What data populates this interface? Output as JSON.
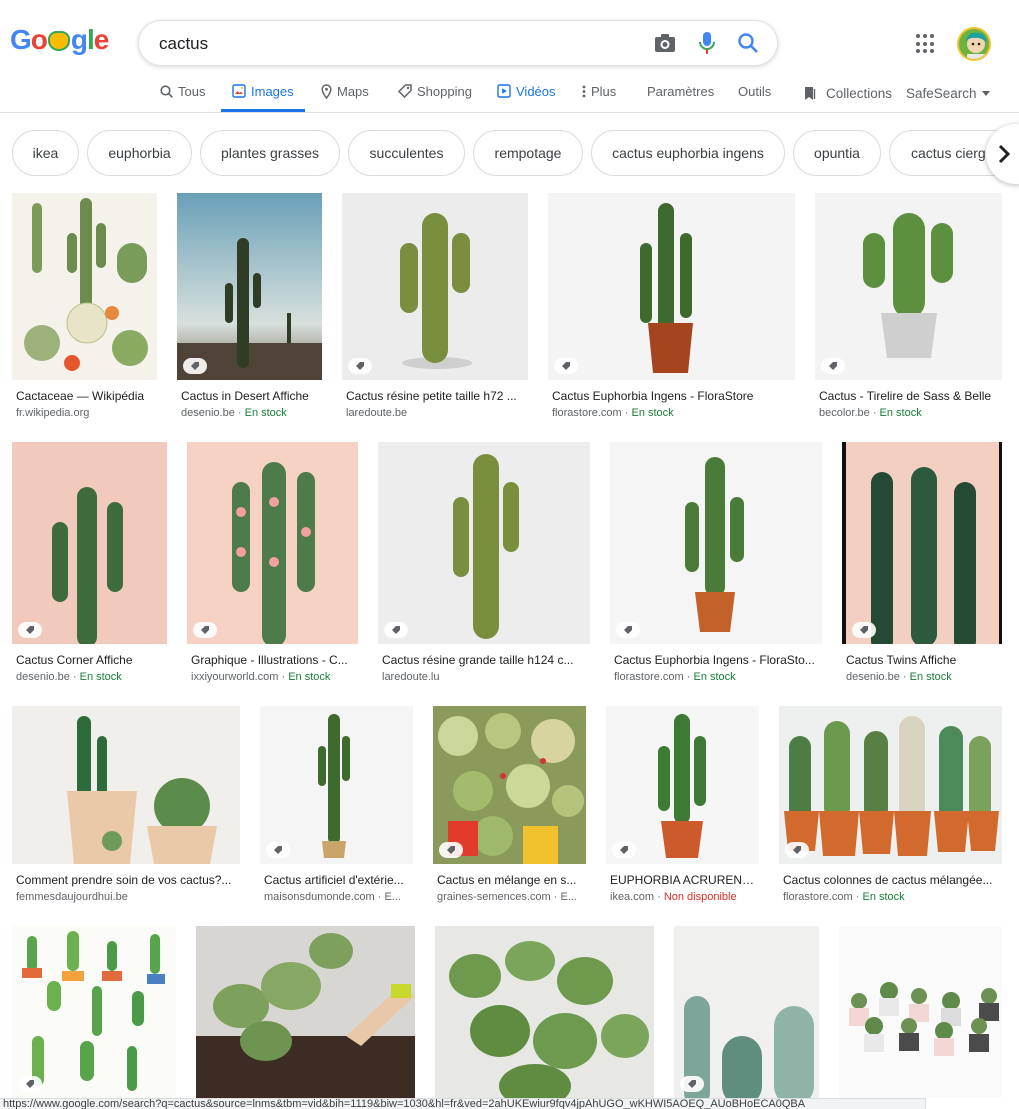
{
  "logo": {
    "text": "Google"
  },
  "search": {
    "query": "cactus",
    "icons": [
      "camera-icon",
      "microphone-icon",
      "search-icon"
    ]
  },
  "tabs": [
    {
      "label": "Tous",
      "icon": "search-icon"
    },
    {
      "label": "Images",
      "icon": "image-icon",
      "active": true
    },
    {
      "label": "Maps",
      "icon": "map-pin-icon"
    },
    {
      "label": "Shopping",
      "icon": "tag-icon"
    },
    {
      "label": "Vidéos",
      "icon": "play-icon"
    },
    {
      "label": "Plus",
      "icon": "more-vert-icon"
    },
    {
      "label": "Paramètres"
    },
    {
      "label": "Outils"
    }
  ],
  "right_tools": {
    "collections": "Collections",
    "safesearch": "SafeSearch"
  },
  "chips": [
    "ikea",
    "euphorbia",
    "plantes grasses",
    "succulentes",
    "rempotage",
    "cactus euphorbia ingens",
    "opuntia",
    "cactus cierge"
  ],
  "results": [
    {
      "title": "Cactaceae — Wikipédia",
      "source": "fr.wikipedia.org",
      "stock": ""
    },
    {
      "title": "Cactus in Desert Affiche",
      "source": "desenio.be",
      "stock": "En stock"
    },
    {
      "title": "Cactus résine petite taille h72 ...",
      "source": "laredoute.be",
      "stock": ""
    },
    {
      "title": "Cactus Euphorbia Ingens - FloraStore",
      "source": "florastore.com",
      "stock": "En stock"
    },
    {
      "title": "Cactus - Tirelire de Sass & Belle",
      "source": "becolor.be",
      "stock": "En stock"
    },
    {
      "title": "Cactus Corner Affiche",
      "source": "desenio.be",
      "stock": "En stock"
    },
    {
      "title": "Graphique - Illustrations - C...",
      "source": "ixxiyourworld.com",
      "stock": "En stock"
    },
    {
      "title": "Cactus résine grande taille h124 c...",
      "source": "laredoute.lu",
      "stock": ""
    },
    {
      "title": "Cactus Euphorbia Ingens - FloraSto...",
      "source": "florastore.com",
      "stock": "En stock"
    },
    {
      "title": "Cactus Twins Affiche",
      "source": "desenio.be",
      "stock": "En stock"
    },
    {
      "title": "Comment prendre soin de vos cactus?...",
      "source": "femmesdaujourdhui.be",
      "stock": ""
    },
    {
      "title": "Cactus artificiel d'extérie...",
      "source": "maisonsdumonde.com · E...",
      "stock": ""
    },
    {
      "title": "Cactus en mélange en s...",
      "source": "graines-semences.com · E...",
      "stock": ""
    },
    {
      "title": "EUPHORBIA ACRURENSI...",
      "source": "ikea.com",
      "stock": "Non disponible"
    },
    {
      "title": "Cactus colonnes de cactus mélangée...",
      "source": "florastore.com",
      "stock": "En stock"
    },
    {
      "title": "",
      "source": "",
      "stock": ""
    },
    {
      "title": "",
      "source": "",
      "stock": ""
    },
    {
      "title": "",
      "source": "",
      "stock": ""
    },
    {
      "title": "",
      "source": "",
      "stock": ""
    },
    {
      "title": "",
      "source": "",
      "stock": ""
    }
  ],
  "status_url": "https://www.google.com/search?q=cactus&source=lnms&tbm=vid&bih=1119&biw=1030&hl=fr&ved=2ahUKEwiur9fqv4jpAhUGO_wKHWI5AOEQ_AUoBHoECA0QBA"
}
